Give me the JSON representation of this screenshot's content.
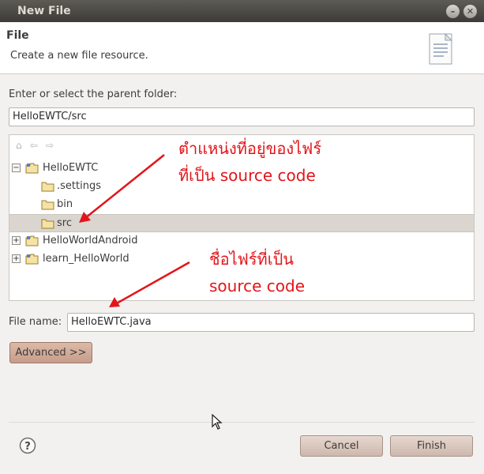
{
  "window": {
    "title": "New File",
    "minimize_glyph": "–",
    "close_glyph": "✕"
  },
  "header": {
    "title": "File",
    "description": "Create a new file resource.",
    "icon": "document-icon"
  },
  "parent_folder": {
    "label": "Enter or select the parent folder:",
    "value": "HelloEWTC/src"
  },
  "tree_toolbar": {
    "icons": [
      "home-icon",
      "back-arrow-icon",
      "forward-arrow-icon"
    ]
  },
  "tree": {
    "items": [
      {
        "label": "HelloEWTC",
        "expander": "−",
        "type": "project"
      },
      {
        "label": ".settings",
        "type": "folder"
      },
      {
        "label": "bin",
        "type": "folder"
      },
      {
        "label": "src",
        "type": "folder",
        "selected": true
      },
      {
        "label": "HelloWorldAndroid",
        "expander": "+",
        "type": "project"
      },
      {
        "label": "learn_HelloWorld",
        "expander": "+",
        "type": "project"
      }
    ]
  },
  "annotations": {
    "folder_note_line1": "ตำแหน่งที่อยู่ของไฟร์",
    "folder_note_line2": "ที่เป็น source code",
    "filename_note_line1": "ชื่อไฟร์ที่เป็น",
    "filename_note_line2": "source code",
    "color": "#e2151a"
  },
  "file_name": {
    "label": "File name:",
    "value": "HelloEWTC.java"
  },
  "buttons": {
    "advanced": "Advanced >>",
    "cancel": "Cancel",
    "finish": "Finish",
    "help_glyph": "?"
  },
  "colors": {
    "titlebar": "#3d3b37",
    "dialog_bg": "#f2f1f0",
    "selection": "#dad6cf",
    "advanced_button": "#c69d8a"
  }
}
